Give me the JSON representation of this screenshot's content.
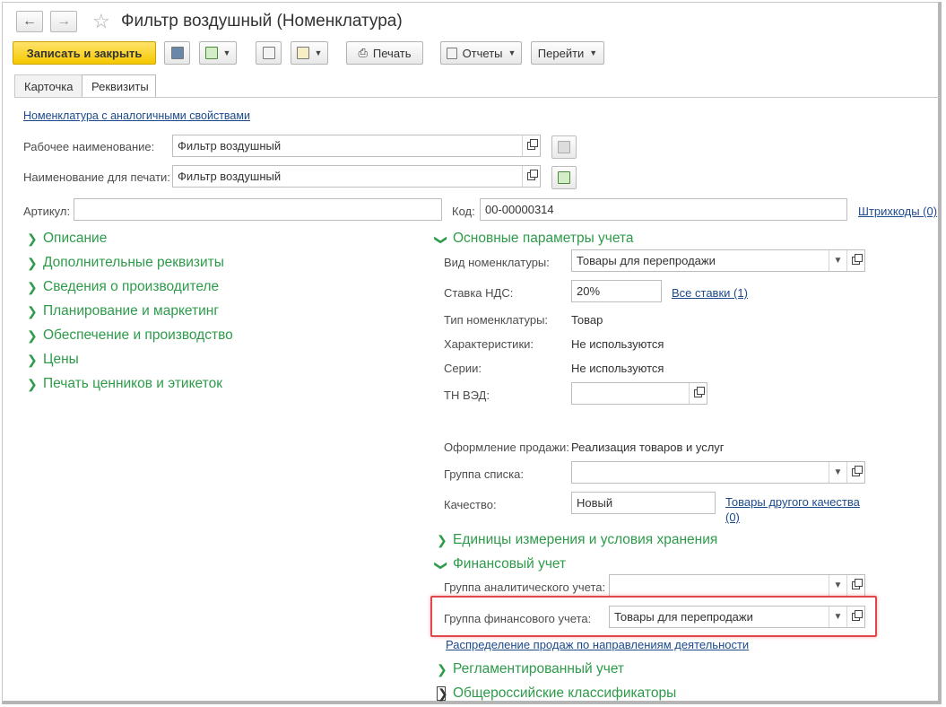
{
  "window": {
    "title": "Фильтр воздушный (Номенклатура)",
    "back_icon": "arrow-left-icon",
    "forward_icon": "arrow-right-icon",
    "favorite_icon": "star-icon"
  },
  "toolbar": {
    "save_close": "Записать и закрыть",
    "print": "Печать",
    "reports": "Отчеты",
    "goto": "Перейти"
  },
  "tabs": [
    {
      "label": "Карточка",
      "active": false
    },
    {
      "label": "Реквизиты",
      "active": true
    }
  ],
  "top_link": "Номенклатура с аналогичными свойствами",
  "fields": {
    "work_name_label": "Рабочее наименование:",
    "work_name_value": "Фильтр воздушный",
    "print_name_label": "Наименование для печати:",
    "print_name_value": "Фильтр воздушный",
    "article_label": "Артикул:",
    "article_value": "",
    "code_label": "Код:",
    "code_value": "00-00000314",
    "barcodes_link": "Штрихкоды (0)"
  },
  "left_sections": [
    "Описание",
    "Дополнительные реквизиты",
    "Сведения о производителе",
    "Планирование и маркетинг",
    "Обеспечение и производство",
    "Цены",
    "Печать ценников и этикеток"
  ],
  "main_params": {
    "title": "Основные параметры учета",
    "kind_label": "Вид номенклатуры:",
    "kind_value": "Товары для перепродажи",
    "vat_label": "Ставка НДС:",
    "vat_value": "20%",
    "all_rates_link": "Все ставки (1)",
    "type_label": "Тип номенклатуры:",
    "type_value": "Товар",
    "chars_label": "Характеристики:",
    "chars_value": "Не используются",
    "series_label": "Серии:",
    "series_value": "Не используются",
    "tnved_label": "ТН ВЭД:",
    "tnved_value": "",
    "sale_label": "Оформление продажи:",
    "sale_value": "Реализация товаров и услуг",
    "list_group_label": "Группа списка:",
    "list_group_value": "",
    "quality_label": "Качество:",
    "quality_value": "Новый",
    "other_quality_link_1": "Товары другого качества",
    "other_quality_link_2": "(0)"
  },
  "units_section": "Единицы измерения и условия хранения",
  "finance": {
    "title": "Финансовый учет",
    "analytic_label": "Группа аналитического учета:",
    "analytic_value": "",
    "fin_group_label": "Группа финансового учета:",
    "fin_group_value": "Товары для перепродажи",
    "distribution_link": "Распределение продаж по направлениям деятельности"
  },
  "reg_section": "Регламентированный учет",
  "classifiers_section": "Общероссийские классификаторы",
  "colors": {
    "section_green": "#2d9b4a",
    "primary_yellow": "#f5c800",
    "highlight_red": "#e0464a",
    "link_blue": "#1c4a8c"
  }
}
